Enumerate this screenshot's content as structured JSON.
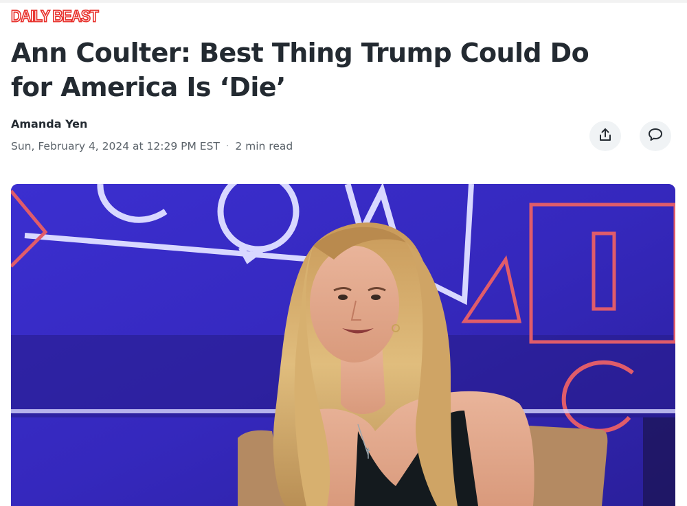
{
  "header": {
    "logo_text": "DAILY BEAST",
    "brand_color": "#e8322d"
  },
  "article": {
    "headline": "Ann Coulter: Best Thing Trump Could Do for America Is ‘Die’",
    "author": "Amanda Yen",
    "date": "Sun, February 4, 2024 at 12:29 PM EST",
    "separator": "·",
    "read_time": "2 min read"
  },
  "actions": {
    "share_icon": "share-icon",
    "comment_icon": "comment-icon"
  },
  "hero_image": {
    "subject": "photo-woman-on-stage",
    "backdrop_color": "#3a2cc4"
  }
}
